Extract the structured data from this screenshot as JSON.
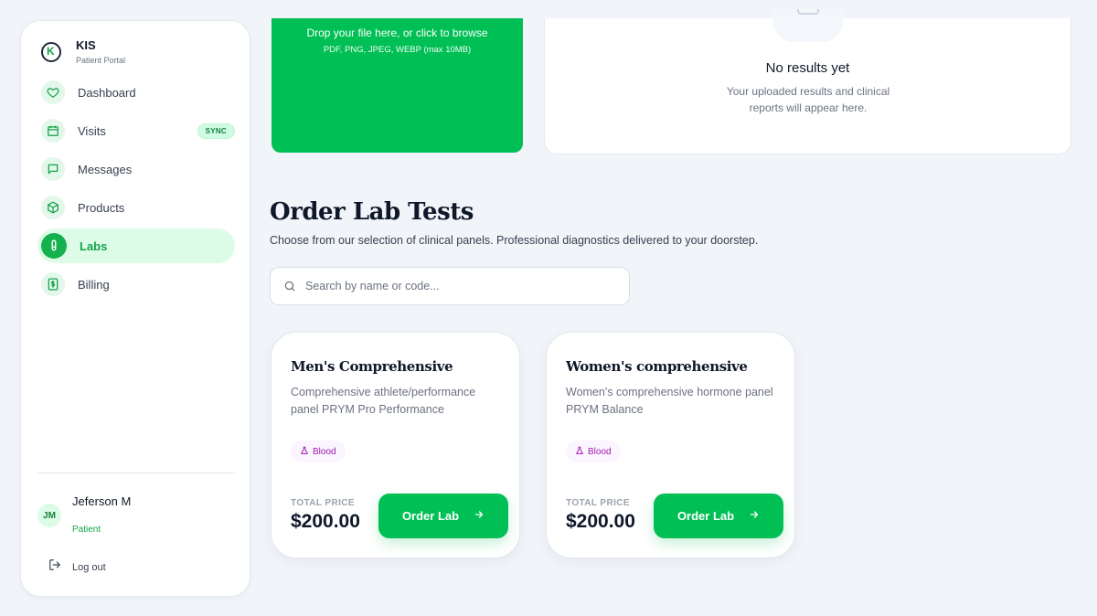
{
  "brand": {
    "logo_letter": "K",
    "name": "KIS",
    "subtitle": "Patient Portal"
  },
  "sidebar": {
    "items": [
      {
        "label": "Dashboard",
        "icon": "heart-icon"
      },
      {
        "label": "Visits",
        "icon": "calendar-icon",
        "badge": "SYNC"
      },
      {
        "label": "Messages",
        "icon": "message-icon"
      },
      {
        "label": "Products",
        "icon": "box-icon"
      },
      {
        "label": "Labs",
        "icon": "test-tube-icon",
        "active": true
      },
      {
        "label": "Billing",
        "icon": "dollar-receipt-icon"
      }
    ]
  },
  "user": {
    "initials": "JM",
    "name": "Jeferson M",
    "role": "Patient"
  },
  "logout": {
    "label": "Log out"
  },
  "upload": {
    "title": "Drop your file here, or click to browse",
    "formats": "PDF, PNG, JPEG, WEBP (max 10MB)"
  },
  "results": {
    "title": "No results yet",
    "subtitle": "Your uploaded results and clinical reports will appear here."
  },
  "order": {
    "title": "Order Lab Tests",
    "subtitle": "Choose from our selection of clinical panels. Professional diagnostics delivered to your doorstep."
  },
  "search": {
    "placeholder": "Search by name or code...",
    "value": ""
  },
  "cards": [
    {
      "title": "Men's Comprehensive",
      "description": "Comprehensive athlete/performance panel PRYM Pro Performance",
      "tag": "Blood",
      "price_label": "TOTAL PRICE",
      "price": "$200.00",
      "button": "Order Lab"
    },
    {
      "title": "Women's comprehensive",
      "description": "Women's comprehensive hormone panel PRYM Balance",
      "tag": "Blood",
      "price_label": "TOTAL PRICE",
      "price": "$200.00",
      "button": "Order Lab"
    }
  ],
  "colors": {
    "accent": "#00c055",
    "accent_soft": "#dcfce7",
    "tag_text": "#a21caf",
    "background": "#f1f4f8"
  }
}
